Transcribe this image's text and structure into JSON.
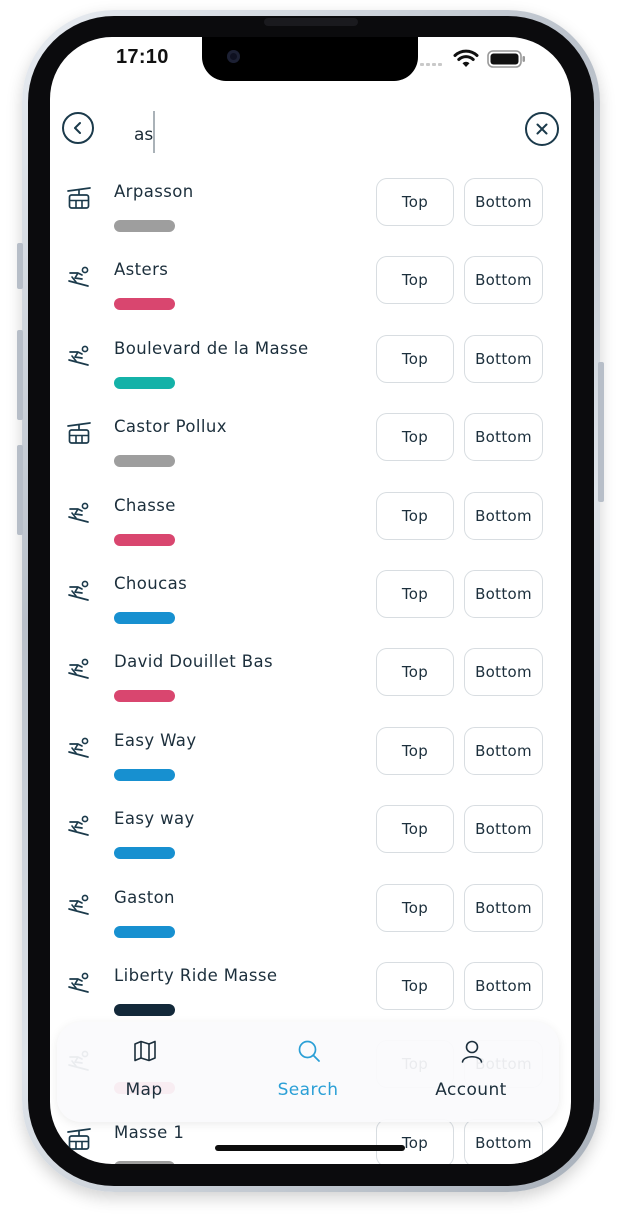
{
  "status": {
    "time": "17:10"
  },
  "search": {
    "value": "as"
  },
  "buttons": {
    "top_label": "Top",
    "bottom_label": "Bottom"
  },
  "results": [
    {
      "name": "Arpasson",
      "type": "lift",
      "icon": "gondola-lift-icon",
      "color": "#9e9e9e"
    },
    {
      "name": "Asters",
      "type": "slope",
      "icon": "skier-icon",
      "color": "#d9466f"
    },
    {
      "name": "Boulevard de la Masse",
      "type": "slope",
      "icon": "skier-icon",
      "color": "#14b2a8"
    },
    {
      "name": "Castor Pollux",
      "type": "lift",
      "icon": "gondola-lift-icon",
      "color": "#9e9e9e"
    },
    {
      "name": "Chasse",
      "type": "slope",
      "icon": "skier-icon",
      "color": "#d9466f"
    },
    {
      "name": "Choucas",
      "type": "slope",
      "icon": "skier-icon",
      "color": "#1790d0"
    },
    {
      "name": "David Douillet Bas",
      "type": "slope",
      "icon": "skier-icon",
      "color": "#d9466f"
    },
    {
      "name": "Easy Way",
      "type": "slope",
      "icon": "skier-icon",
      "color": "#1790d0"
    },
    {
      "name": "Easy way",
      "type": "slope",
      "icon": "skier-icon",
      "color": "#1790d0"
    },
    {
      "name": "Gaston",
      "type": "slope",
      "icon": "skier-icon",
      "color": "#1790d0"
    },
    {
      "name": "Liberty Ride Masse",
      "type": "slope",
      "icon": "skier-icon",
      "color": "#13293a"
    },
    {
      "name": "",
      "type": "slope",
      "icon": "skier-icon",
      "color": "#d9466f"
    },
    {
      "name": "Masse 1",
      "type": "lift",
      "icon": "gondola-lift-icon",
      "color": "#9e9e9e"
    }
  ],
  "tabs": [
    {
      "label": "Map",
      "icon": "map-icon",
      "active": false
    },
    {
      "label": "Search",
      "icon": "search-icon",
      "active": true
    },
    {
      "label": "Account",
      "icon": "user-icon",
      "active": false
    }
  ],
  "colors": {
    "primary": "#1c2f3c",
    "active_tab": "#2a9fd6",
    "outline": "#1b3a4b"
  }
}
